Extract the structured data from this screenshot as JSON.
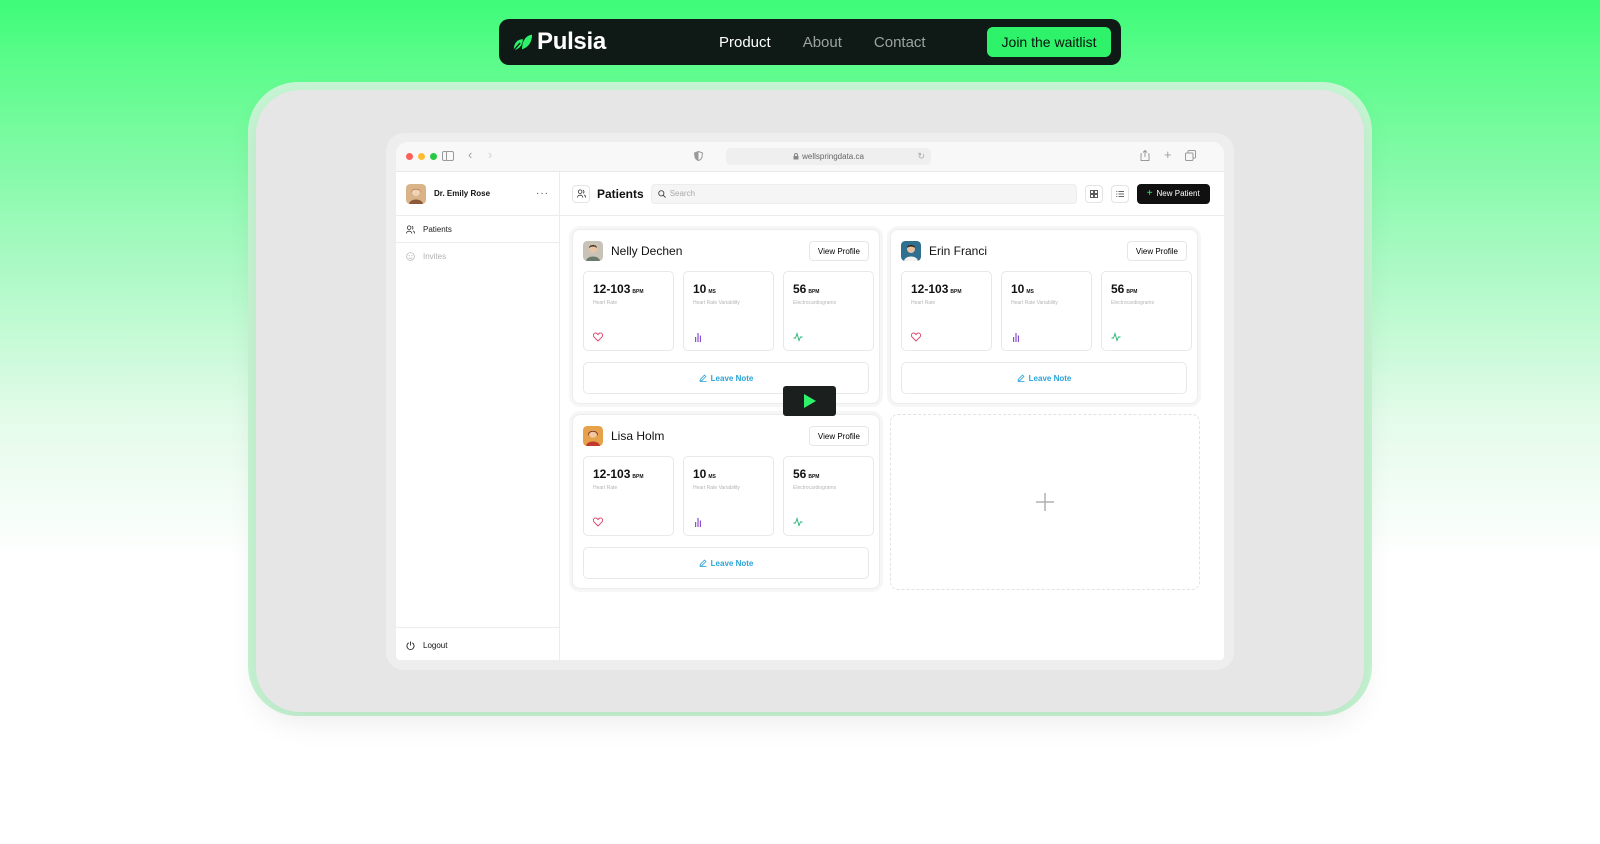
{
  "nav": {
    "brand": "Pulsia",
    "links": [
      "Product",
      "About",
      "Contact"
    ],
    "cta": "Join the waitlist"
  },
  "browser": {
    "url": "wellspringdata.ca"
  },
  "sidebar": {
    "user_name": "Dr. Emily Rose",
    "more": "···",
    "items": [
      {
        "label": "Patients",
        "icon": "users-icon"
      },
      {
        "label": "Invites",
        "icon": "smile-icon"
      }
    ],
    "logout": "Logout"
  },
  "toolbar": {
    "title": "Patients",
    "search_placeholder": "Search",
    "new_patient": "New Patient"
  },
  "patients": [
    {
      "name": "Nelly Dechen",
      "view_profile": "View Profile",
      "metrics": [
        {
          "value": "12-103",
          "unit": "BPM",
          "label": "Heart Rate",
          "icon": "heart-icon"
        },
        {
          "value": "10",
          "unit": "MS",
          "label": "Heart Rate Variability",
          "icon": "bar-chart-icon"
        },
        {
          "value": "56",
          "unit": "BPM",
          "label": "Electrocardiograms",
          "icon": "pulse-icon"
        }
      ],
      "leave_note": "Leave Note"
    },
    {
      "name": "Erin Franci",
      "view_profile": "View Profile",
      "metrics": [
        {
          "value": "12-103",
          "unit": "BPM",
          "label": "Heart Rate",
          "icon": "heart-icon"
        },
        {
          "value": "10",
          "unit": "MS",
          "label": "Heart Rate Variability",
          "icon": "bar-chart-icon"
        },
        {
          "value": "56",
          "unit": "BPM",
          "label": "Electrocardiograms",
          "icon": "pulse-icon"
        }
      ],
      "leave_note": "Leave Note"
    },
    {
      "name": "Lisa Holm",
      "view_profile": "View Profile",
      "metrics": [
        {
          "value": "12-103",
          "unit": "BPM",
          "label": "Heart Rate",
          "icon": "heart-icon"
        },
        {
          "value": "10",
          "unit": "MS",
          "label": "Heart Rate Variability",
          "icon": "bar-chart-icon"
        },
        {
          "value": "56",
          "unit": "BPM",
          "label": "Electrocardiograms",
          "icon": "pulse-icon"
        }
      ],
      "leave_note": "Leave Note"
    }
  ],
  "colors": {
    "accent": "#2ff26b",
    "nav_bg": "#0f1a17",
    "link_blue": "#2aa3d8",
    "heart": "#e0406a",
    "bars": "#8a4fd0",
    "pulse": "#22b573"
  }
}
